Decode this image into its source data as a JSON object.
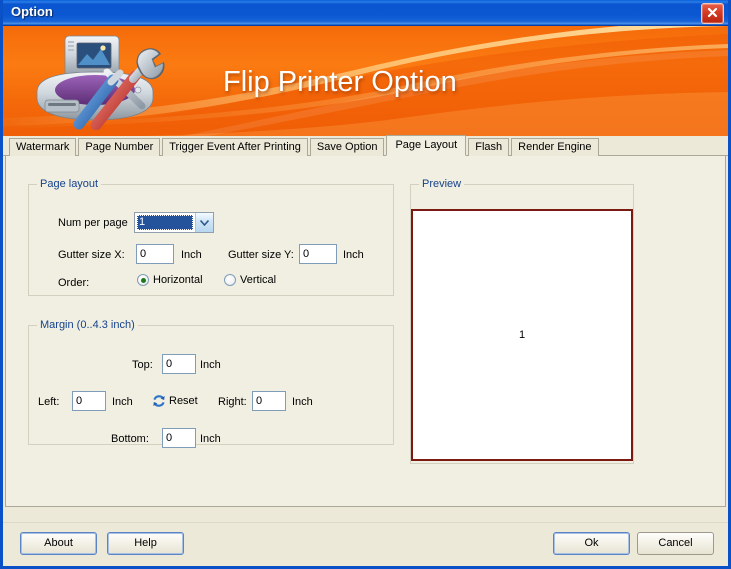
{
  "window": {
    "title": "Option",
    "close_icon": "close-icon"
  },
  "banner": {
    "title": "Flip Printer Option",
    "art_icon": "printer-tools-icon",
    "bg_color": "#f4690a"
  },
  "tabs": [
    {
      "label": "Watermark",
      "accel": "W",
      "active": false
    },
    {
      "label": "Page Number",
      "accel": "N",
      "active": false
    },
    {
      "label": "Trigger Event After Printing",
      "accel": "T",
      "active": false
    },
    {
      "label": "Save Option",
      "accel": "t",
      "active": false
    },
    {
      "label": "Page Layout",
      "accel": "L",
      "active": true
    },
    {
      "label": "Flash",
      "accel": "F",
      "active": false
    },
    {
      "label": "Render Engine",
      "accel": "",
      "active": false
    }
  ],
  "page_layout": {
    "group_title": "Page layout",
    "num_per_page_label": "Num per page",
    "num_per_page_value": "1",
    "gutter_x_label": "Gutter size X:",
    "gutter_x_value": "0",
    "gutter_x_unit": "Inch",
    "gutter_y_label": "Gutter size Y:",
    "gutter_y_value": "0",
    "gutter_y_unit": "Inch",
    "order_label": "Order:",
    "order_horizontal": "Horizontal",
    "order_vertical": "Vertical",
    "order_selected": "Horizontal"
  },
  "margin": {
    "group_title": "Margin (0..4.3 inch)",
    "top_label": "Top:",
    "top_value": "0",
    "top_unit": "Inch",
    "left_label": "Left:",
    "left_value": "0",
    "left_unit": "Inch",
    "right_label": "Right:",
    "right_value": "0",
    "right_unit": "Inch",
    "bottom_label": "Bottom:",
    "bottom_value": "0",
    "bottom_unit": "Inch",
    "reset_label": "Reset",
    "reset_icon": "refresh-arrows-icon"
  },
  "preview": {
    "group_title": "Preview",
    "page_number": "1",
    "border_color": "#7b1a10"
  },
  "footer": {
    "about_label": "About",
    "help_label": "Help",
    "ok_label": "Ok",
    "cancel_label": "Cancel"
  }
}
